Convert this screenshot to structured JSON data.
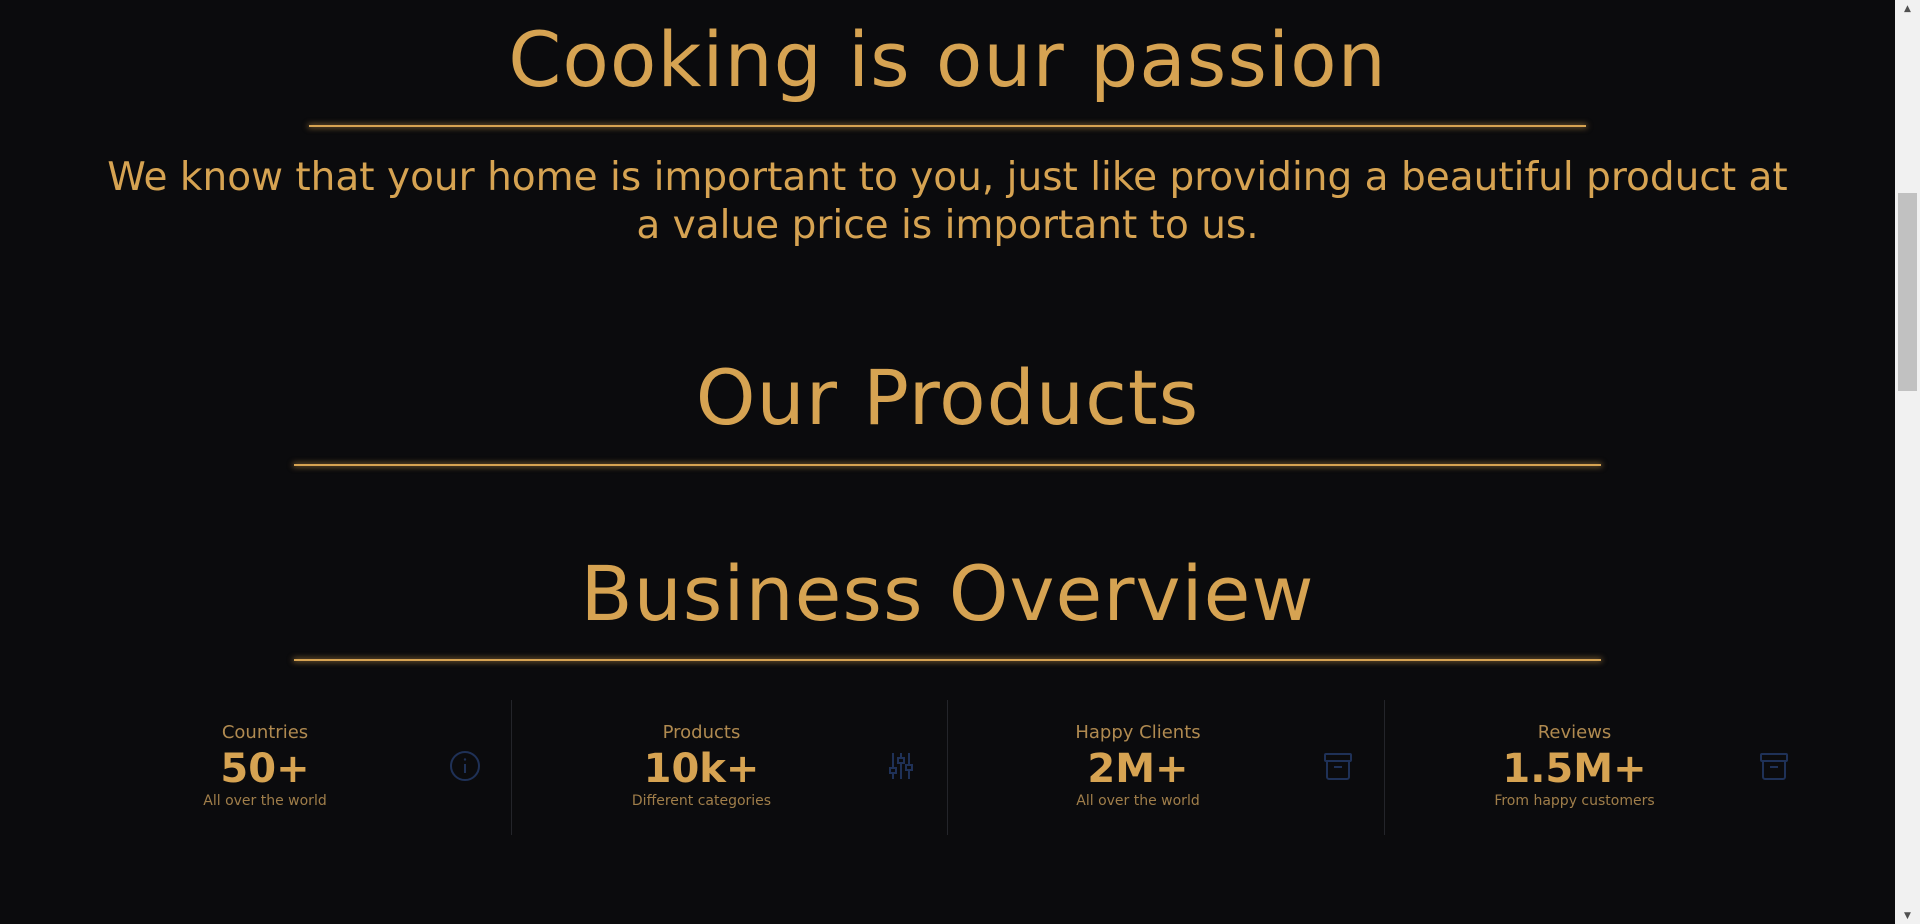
{
  "sections": {
    "cooking_title": "Cooking is our passion",
    "intro_text": "We know that your home is important to you, just like providing a beautiful product at a value price is important to us.",
    "products_title": "Our Products",
    "business_title": "Business Overview"
  },
  "stats": [
    {
      "title": "Countries",
      "value": "50+",
      "desc": "All over the world",
      "icon": "info-icon"
    },
    {
      "title": "Products",
      "value": "10k+",
      "desc": "Different categories",
      "icon": "sliders-icon"
    },
    {
      "title": "Happy Clients",
      "value": "2M+",
      "desc": "All over the world",
      "icon": "archive-icon"
    },
    {
      "title": "Reviews",
      "value": "1.5M+",
      "desc": "From happy customers",
      "icon": "archive-icon"
    }
  ],
  "colors": {
    "background": "#0b0b0d",
    "accent": "#d6a352",
    "icon": "#1a2a4a"
  }
}
